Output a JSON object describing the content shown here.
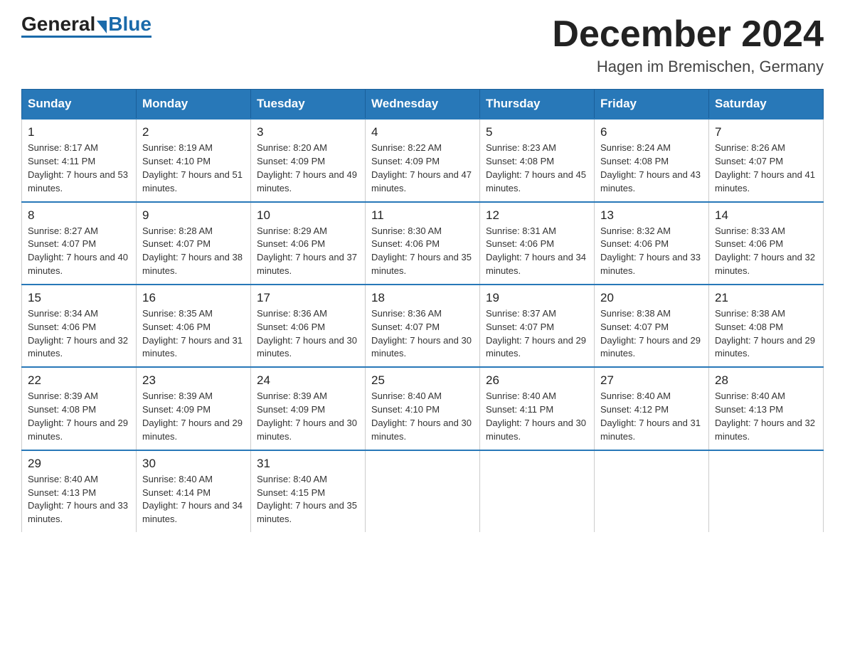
{
  "logo": {
    "general": "General",
    "arrow": "",
    "blue": "Blue"
  },
  "title": "December 2024",
  "subtitle": "Hagen im Bremischen, Germany",
  "days_of_week": [
    "Sunday",
    "Monday",
    "Tuesday",
    "Wednesday",
    "Thursday",
    "Friday",
    "Saturday"
  ],
  "weeks": [
    [
      {
        "day": "1",
        "sunrise": "8:17 AM",
        "sunset": "4:11 PM",
        "daylight": "7 hours and 53 minutes."
      },
      {
        "day": "2",
        "sunrise": "8:19 AM",
        "sunset": "4:10 PM",
        "daylight": "7 hours and 51 minutes."
      },
      {
        "day": "3",
        "sunrise": "8:20 AM",
        "sunset": "4:09 PM",
        "daylight": "7 hours and 49 minutes."
      },
      {
        "day": "4",
        "sunrise": "8:22 AM",
        "sunset": "4:09 PM",
        "daylight": "7 hours and 47 minutes."
      },
      {
        "day": "5",
        "sunrise": "8:23 AM",
        "sunset": "4:08 PM",
        "daylight": "7 hours and 45 minutes."
      },
      {
        "day": "6",
        "sunrise": "8:24 AM",
        "sunset": "4:08 PM",
        "daylight": "7 hours and 43 minutes."
      },
      {
        "day": "7",
        "sunrise": "8:26 AM",
        "sunset": "4:07 PM",
        "daylight": "7 hours and 41 minutes."
      }
    ],
    [
      {
        "day": "8",
        "sunrise": "8:27 AM",
        "sunset": "4:07 PM",
        "daylight": "7 hours and 40 minutes."
      },
      {
        "day": "9",
        "sunrise": "8:28 AM",
        "sunset": "4:07 PM",
        "daylight": "7 hours and 38 minutes."
      },
      {
        "day": "10",
        "sunrise": "8:29 AM",
        "sunset": "4:06 PM",
        "daylight": "7 hours and 37 minutes."
      },
      {
        "day": "11",
        "sunrise": "8:30 AM",
        "sunset": "4:06 PM",
        "daylight": "7 hours and 35 minutes."
      },
      {
        "day": "12",
        "sunrise": "8:31 AM",
        "sunset": "4:06 PM",
        "daylight": "7 hours and 34 minutes."
      },
      {
        "day": "13",
        "sunrise": "8:32 AM",
        "sunset": "4:06 PM",
        "daylight": "7 hours and 33 minutes."
      },
      {
        "day": "14",
        "sunrise": "8:33 AM",
        "sunset": "4:06 PM",
        "daylight": "7 hours and 32 minutes."
      }
    ],
    [
      {
        "day": "15",
        "sunrise": "8:34 AM",
        "sunset": "4:06 PM",
        "daylight": "7 hours and 32 minutes."
      },
      {
        "day": "16",
        "sunrise": "8:35 AM",
        "sunset": "4:06 PM",
        "daylight": "7 hours and 31 minutes."
      },
      {
        "day": "17",
        "sunrise": "8:36 AM",
        "sunset": "4:06 PM",
        "daylight": "7 hours and 30 minutes."
      },
      {
        "day": "18",
        "sunrise": "8:36 AM",
        "sunset": "4:07 PM",
        "daylight": "7 hours and 30 minutes."
      },
      {
        "day": "19",
        "sunrise": "8:37 AM",
        "sunset": "4:07 PM",
        "daylight": "7 hours and 29 minutes."
      },
      {
        "day": "20",
        "sunrise": "8:38 AM",
        "sunset": "4:07 PM",
        "daylight": "7 hours and 29 minutes."
      },
      {
        "day": "21",
        "sunrise": "8:38 AM",
        "sunset": "4:08 PM",
        "daylight": "7 hours and 29 minutes."
      }
    ],
    [
      {
        "day": "22",
        "sunrise": "8:39 AM",
        "sunset": "4:08 PM",
        "daylight": "7 hours and 29 minutes."
      },
      {
        "day": "23",
        "sunrise": "8:39 AM",
        "sunset": "4:09 PM",
        "daylight": "7 hours and 29 minutes."
      },
      {
        "day": "24",
        "sunrise": "8:39 AM",
        "sunset": "4:09 PM",
        "daylight": "7 hours and 30 minutes."
      },
      {
        "day": "25",
        "sunrise": "8:40 AM",
        "sunset": "4:10 PM",
        "daylight": "7 hours and 30 minutes."
      },
      {
        "day": "26",
        "sunrise": "8:40 AM",
        "sunset": "4:11 PM",
        "daylight": "7 hours and 30 minutes."
      },
      {
        "day": "27",
        "sunrise": "8:40 AM",
        "sunset": "4:12 PM",
        "daylight": "7 hours and 31 minutes."
      },
      {
        "day": "28",
        "sunrise": "8:40 AM",
        "sunset": "4:13 PM",
        "daylight": "7 hours and 32 minutes."
      }
    ],
    [
      {
        "day": "29",
        "sunrise": "8:40 AM",
        "sunset": "4:13 PM",
        "daylight": "7 hours and 33 minutes."
      },
      {
        "day": "30",
        "sunrise": "8:40 AM",
        "sunset": "4:14 PM",
        "daylight": "7 hours and 34 minutes."
      },
      {
        "day": "31",
        "sunrise": "8:40 AM",
        "sunset": "4:15 PM",
        "daylight": "7 hours and 35 minutes."
      },
      null,
      null,
      null,
      null
    ]
  ]
}
